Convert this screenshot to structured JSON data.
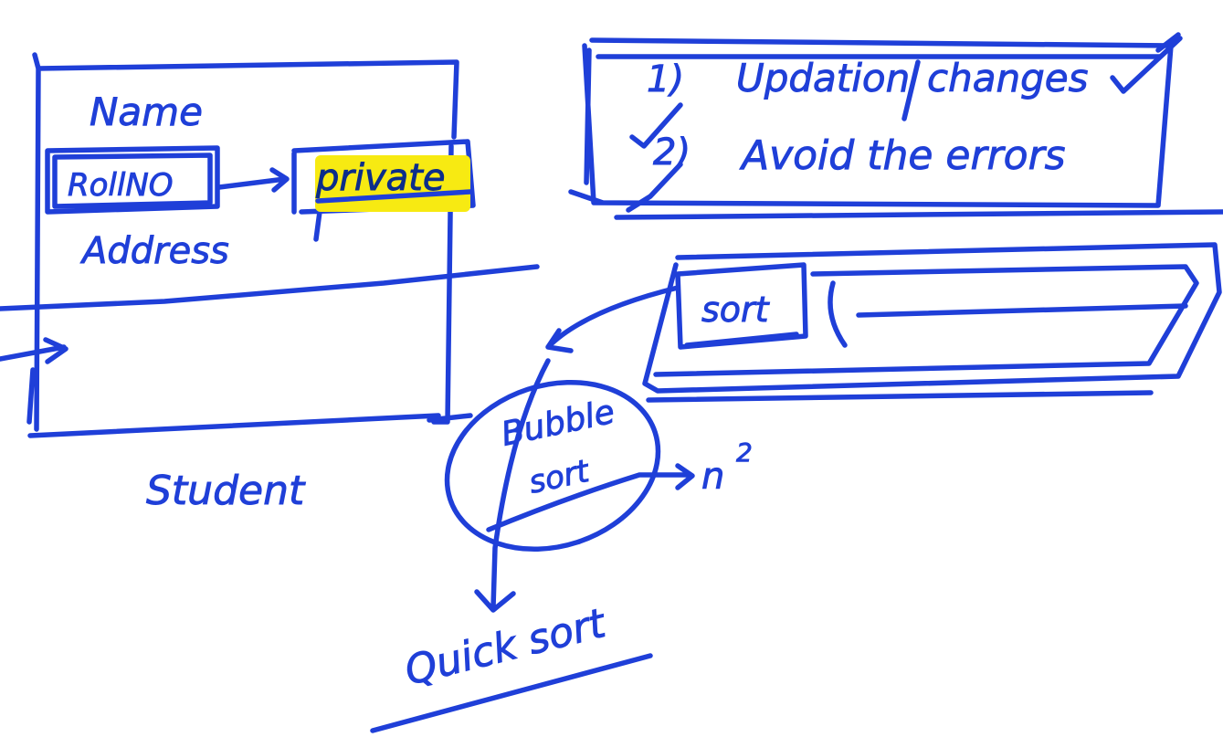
{
  "board": {
    "ink_color": "#1f3fd8",
    "highlight_color": "#f7ea12",
    "background": "#ffffff"
  },
  "left": {
    "name_label": "Name",
    "rollno_label": "RollNO",
    "private_label": "private",
    "address_label": "Address",
    "student_label": "Student"
  },
  "right_top": {
    "item1_number": "1)",
    "item1_text": "Updation",
    "item1_extra": "changes",
    "item2_number": "2)",
    "item2_text": "Avoid the errors"
  },
  "sort": {
    "sort_label": "sort",
    "bubble_label_line1": "Bubble",
    "bubble_label_line2": "sort",
    "complexity": "n",
    "complexity_exponent": "2",
    "quick_label": "Quick sort"
  }
}
